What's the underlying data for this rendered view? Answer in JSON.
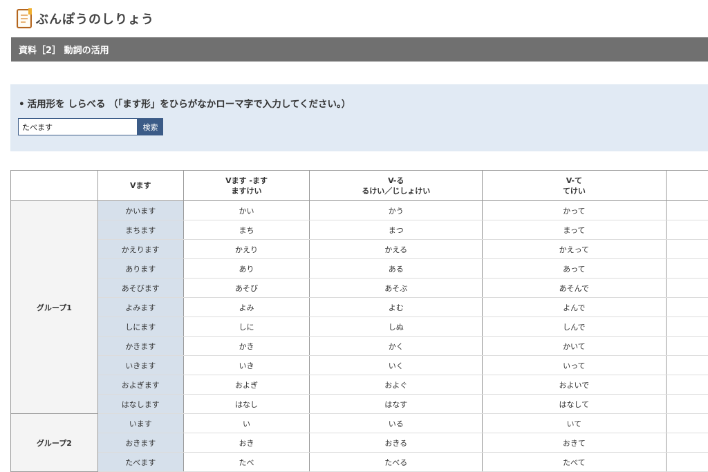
{
  "site": {
    "title": "ぶんぽうのしりょう",
    "logo_icon": "notebook-icon"
  },
  "section": {
    "title": "資料［2］ 動詞の活用"
  },
  "search": {
    "bullet": "•",
    "instruction": "活用形を しらべる （「ます形」をひらがなかローマ字で入力してください。）",
    "value": "たべます",
    "button_label": "検索"
  },
  "table": {
    "headers": [
      {
        "line1": "",
        "line2": ""
      },
      {
        "line1": "Vます",
        "line2": ""
      },
      {
        "line1": "Vます -ます",
        "line2": "ますけい"
      },
      {
        "line1": "V-る",
        "line2": "るけい／じしょけい"
      },
      {
        "line1": "V-て",
        "line2": "てけい"
      },
      {
        "line1": "",
        "line2": ""
      }
    ],
    "groups": [
      {
        "name": "グループ1",
        "rows": [
          [
            "かいます",
            "かい",
            "かう",
            "かって"
          ],
          [
            "まちます",
            "まち",
            "まつ",
            "まって"
          ],
          [
            "かえります",
            "かえり",
            "かえる",
            "かえって"
          ],
          [
            "あります",
            "あり",
            "ある",
            "あって"
          ],
          [
            "あそびます",
            "あそび",
            "あそぶ",
            "あそんで"
          ],
          [
            "よみます",
            "よみ",
            "よむ",
            "よんで"
          ],
          [
            "しにます",
            "しに",
            "しぬ",
            "しんで"
          ],
          [
            "かきます",
            "かき",
            "かく",
            "かいて"
          ],
          [
            "いきます",
            "いき",
            "いく",
            "いって"
          ],
          [
            "およぎます",
            "およぎ",
            "およぐ",
            "およいで"
          ],
          [
            "はなします",
            "はなし",
            "はなす",
            "はなして"
          ]
        ]
      },
      {
        "name": "グループ2",
        "rows": [
          [
            "います",
            "い",
            "いる",
            "いて"
          ],
          [
            "おきます",
            "おき",
            "おきる",
            "おきて"
          ],
          [
            "たべます",
            "たべ",
            "たべる",
            "たべて"
          ]
        ]
      }
    ]
  }
}
